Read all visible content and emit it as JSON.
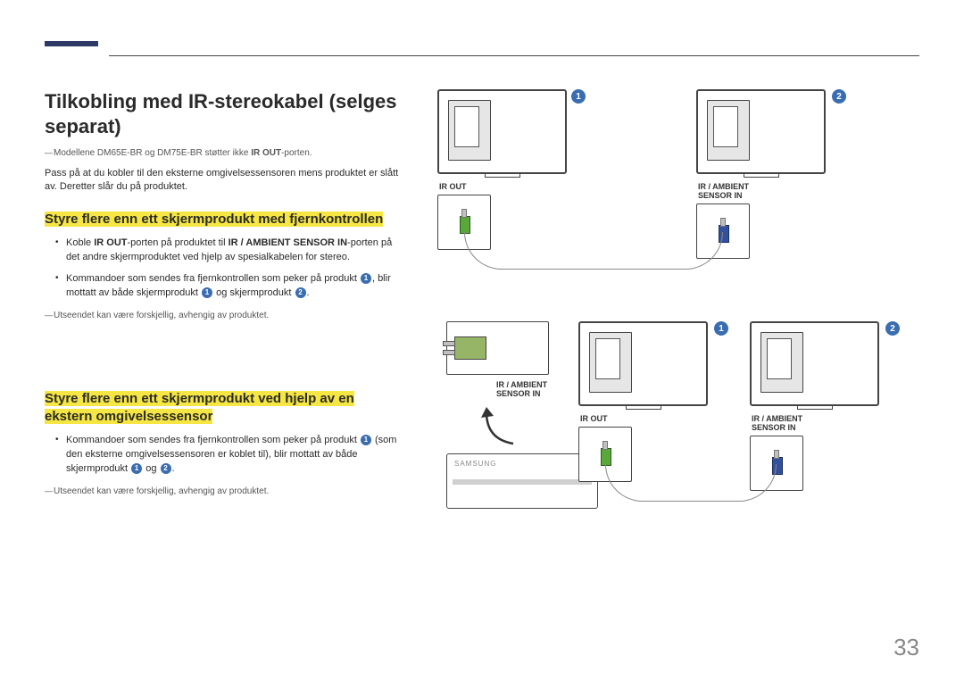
{
  "pageNumber": "33",
  "title": "Tilkobling med IR-stereokabel (selges separat)",
  "note1_pre": "Modellene DM65E-BR og DM75E-BR støtter ikke ",
  "note1_bold": "IR OUT",
  "note1_post": "-porten.",
  "para1": "Pass på at du kobler til den eksterne omgivelsessensoren mens produktet er slått av. Deretter slår du på produktet.",
  "sub1": "Styre flere enn ett skjermprodukt med fjernkontrollen",
  "bullet1a_pre": "Koble ",
  "bullet1a_b1": "IR OUT",
  "bullet1a_mid": "-porten på produktet til ",
  "bullet1a_b2": "IR / AMBIENT SENSOR IN",
  "bullet1a_post": "-porten på det andre skjermproduktet ved hjelp av spesialkabelen for stereo.",
  "bullet1b_pre": "Kommandoer som sendes fra fjernkontrollen som peker på produkt ",
  "bullet1b_mid": ", blir mottatt av både skjermprodukt ",
  "bullet1b_mid2": " og skjermprodukt ",
  "bullet1b_post": ".",
  "note2": "Utseendet kan være forskjellig, avhengig av produktet.",
  "sub2": "Styre flere enn ett skjermprodukt ved hjelp av en ekstern omgivelsessensor",
  "bullet2a_pre": "Kommandoer som sendes fra fjernkontrollen som peker på produkt ",
  "bullet2a_mid": " (som den eksterne omgivelsessensoren er koblet til), blir mottatt av både skjermprodukt ",
  "bullet2a_mid2": " og ",
  "bullet2a_post": ".",
  "note3": "Utseendet kan være forskjellig, avhengig av produktet.",
  "labels": {
    "irout": "IR OUT",
    "irambient": "IR / AMBIENT",
    "sensorin": "SENSOR IN"
  },
  "circled": {
    "one": "1",
    "two": "2"
  }
}
